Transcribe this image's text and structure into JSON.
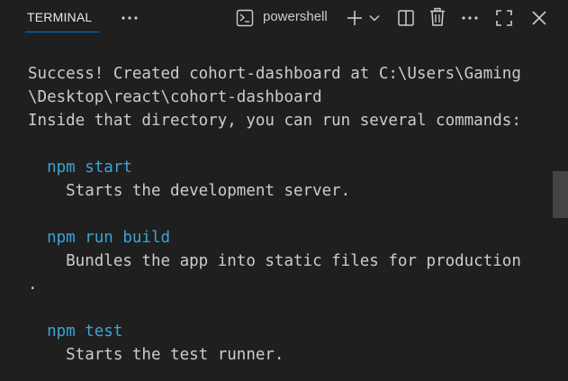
{
  "header": {
    "tab_label": "TERMINAL",
    "more_tab_icon": "ellipsis-icon",
    "shell_icon": "terminal-icon",
    "shell_name": "powershell",
    "new_terminal_icon": "plus-icon",
    "dropdown_icon": "chevron-down-icon",
    "split_icon": "split-icon",
    "trash_icon": "trash-icon",
    "more_icon": "ellipsis-icon",
    "maximize_icon": "maximize-icon",
    "close_icon": "close-icon"
  },
  "terminal": {
    "lines": [
      {
        "text": "Success! Created cohort-dashboard at C:\\Users\\Gaming",
        "kind": "plain"
      },
      {
        "text": "\\Desktop\\react\\cohort-dashboard",
        "kind": "plain"
      },
      {
        "text": "Inside that directory, you can run several commands:",
        "kind": "plain"
      },
      {
        "text": "",
        "kind": "plain"
      },
      {
        "text": "  npm start",
        "kind": "cmd"
      },
      {
        "text": "    Starts the development server.",
        "kind": "plain"
      },
      {
        "text": "",
        "kind": "plain"
      },
      {
        "text": "  npm run build",
        "kind": "cmd"
      },
      {
        "text": "    Bundles the app into static files for production",
        "kind": "plain"
      },
      {
        "text": ".",
        "kind": "plain"
      },
      {
        "text": "",
        "kind": "plain"
      },
      {
        "text": "  npm test",
        "kind": "cmd"
      },
      {
        "text": "    Starts the test runner.",
        "kind": "plain"
      }
    ]
  },
  "colors": {
    "background": "#1f1f1f",
    "text": "#cccccc",
    "command": "#3ba4d8",
    "tab_accent": "#0078d4"
  }
}
